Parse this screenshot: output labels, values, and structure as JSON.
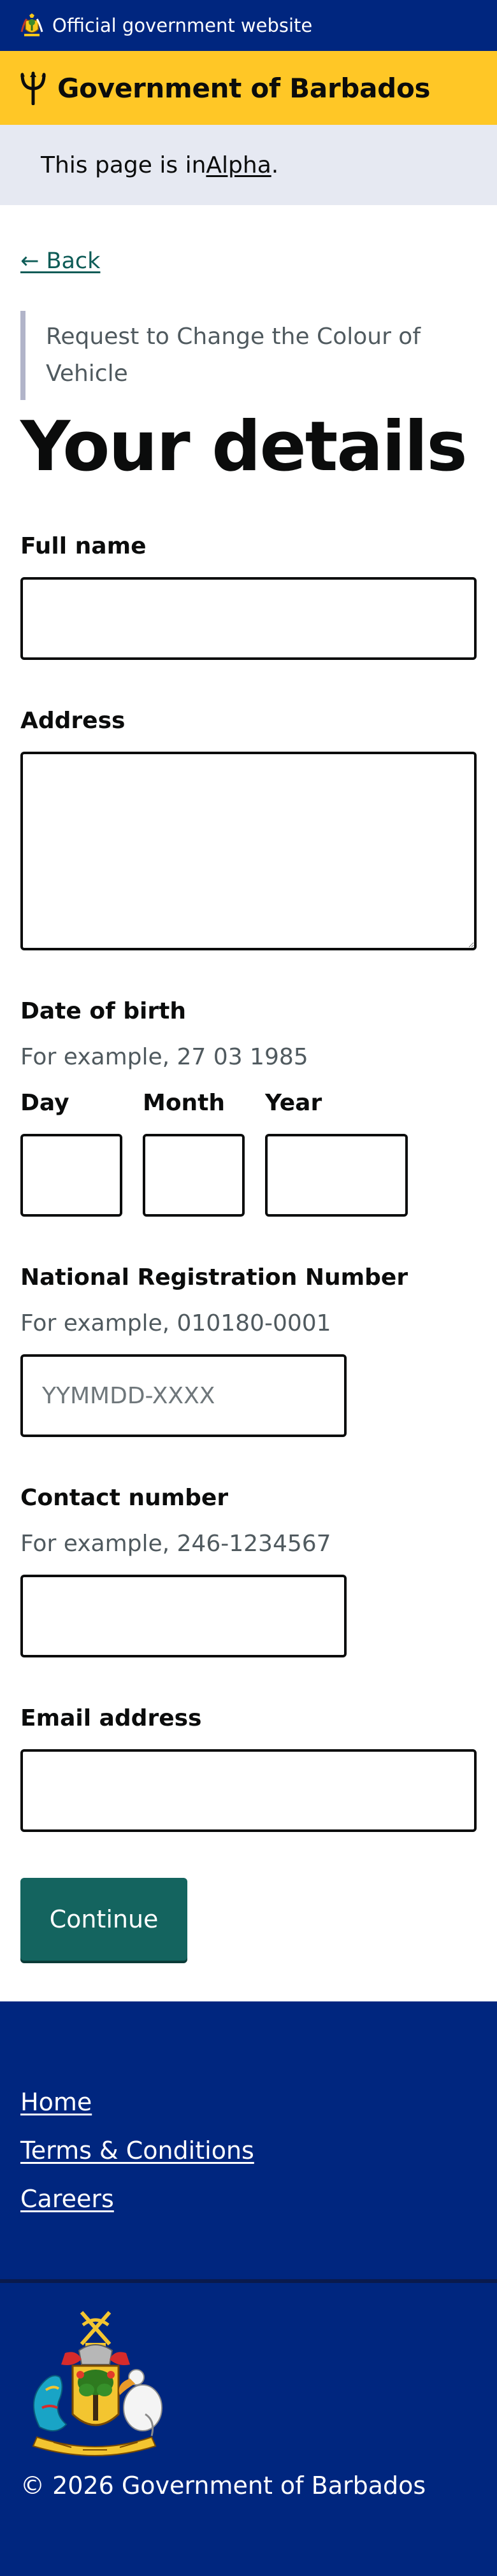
{
  "official_banner": {
    "text": "Official government website",
    "icon": "coat-of-arms-icon"
  },
  "header": {
    "brand": "Government of Barbados",
    "logo_icon": "trident-icon",
    "accent": "#ffc726"
  },
  "phase_banner": {
    "prefix": "This page is in ",
    "tag": "Alpha",
    "suffix": "."
  },
  "back_link": {
    "label": "← Back"
  },
  "form": {
    "caption": "Request to Change the Colour of Vehicle",
    "title": "Your details",
    "full_name": {
      "label": "Full name",
      "value": ""
    },
    "address": {
      "label": "Address",
      "value": ""
    },
    "date_of_birth": {
      "label": "Date of birth",
      "hint": "For example, 27 03 1985",
      "day_label": "Day",
      "month_label": "Month",
      "year_label": "Year"
    },
    "nrn": {
      "label": "National Registration Number",
      "hint": "For example, 010180-0001",
      "placeholder": "YYMMDD-XXXX"
    },
    "contact": {
      "label": "Contact number",
      "hint": "For example, 246-1234567"
    },
    "email": {
      "label": "Email address"
    },
    "continue_label": "Continue"
  },
  "footer": {
    "links": [
      {
        "label": "Home"
      },
      {
        "label": "Terms & Conditions"
      },
      {
        "label": "Careers"
      }
    ],
    "crest_icon": "coat-of-arms-icon",
    "copyright": "© 2026 Government of Barbados"
  },
  "colors": {
    "navy": "#00267f",
    "yellow": "#ffc726",
    "button": "#14645f",
    "link": "#0e5c57"
  }
}
